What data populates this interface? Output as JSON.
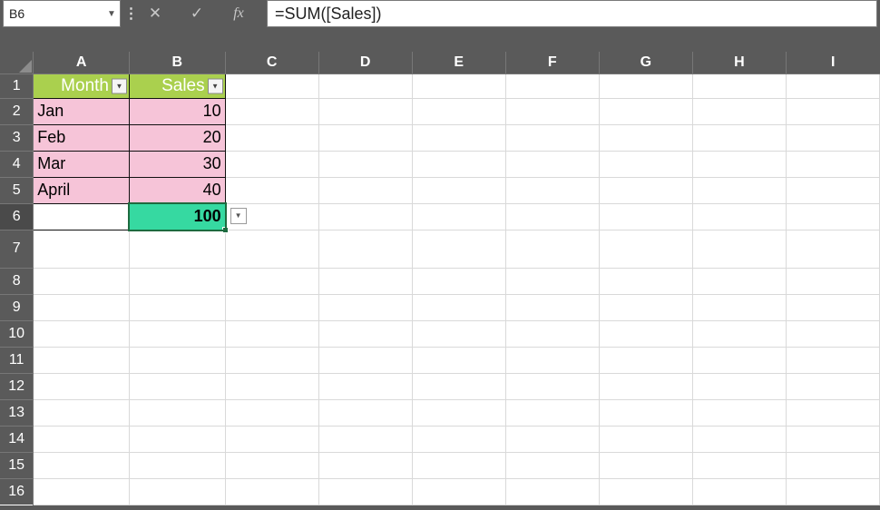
{
  "formula_bar": {
    "name_box": "B6",
    "cancel_glyph": "✕",
    "enter_glyph": "✓",
    "fx_label": "fx",
    "formula": "=SUM([Sales])",
    "vsep_glyph": "⋮"
  },
  "columns": [
    "A",
    "B",
    "C",
    "D",
    "E",
    "F",
    "G",
    "H",
    "I"
  ],
  "rows": [
    "1",
    "2",
    "3",
    "4",
    "5",
    "6",
    "7",
    "8",
    "9",
    "10",
    "11",
    "12",
    "13",
    "14",
    "15",
    "16"
  ],
  "table": {
    "headers": [
      "Month",
      "Sales"
    ],
    "data": [
      {
        "month": "Jan",
        "sales": 10
      },
      {
        "month": "Feb",
        "sales": 20
      },
      {
        "month": "Mar",
        "sales": 30
      },
      {
        "month": "April",
        "sales": 40
      }
    ],
    "total": {
      "label": "",
      "value": 100
    }
  },
  "colors": {
    "header_fill": "#aad04e",
    "data_fill": "#f6c4d8",
    "total_fill": "#36d9a1",
    "selection": "#1d6b3f"
  },
  "chart_data": {
    "type": "table",
    "columns": [
      "Month",
      "Sales"
    ],
    "rows": [
      [
        "Jan",
        10
      ],
      [
        "Feb",
        20
      ],
      [
        "Mar",
        30
      ],
      [
        "April",
        40
      ]
    ],
    "total": [
      "",
      100
    ]
  },
  "dd_glyph": "▼"
}
